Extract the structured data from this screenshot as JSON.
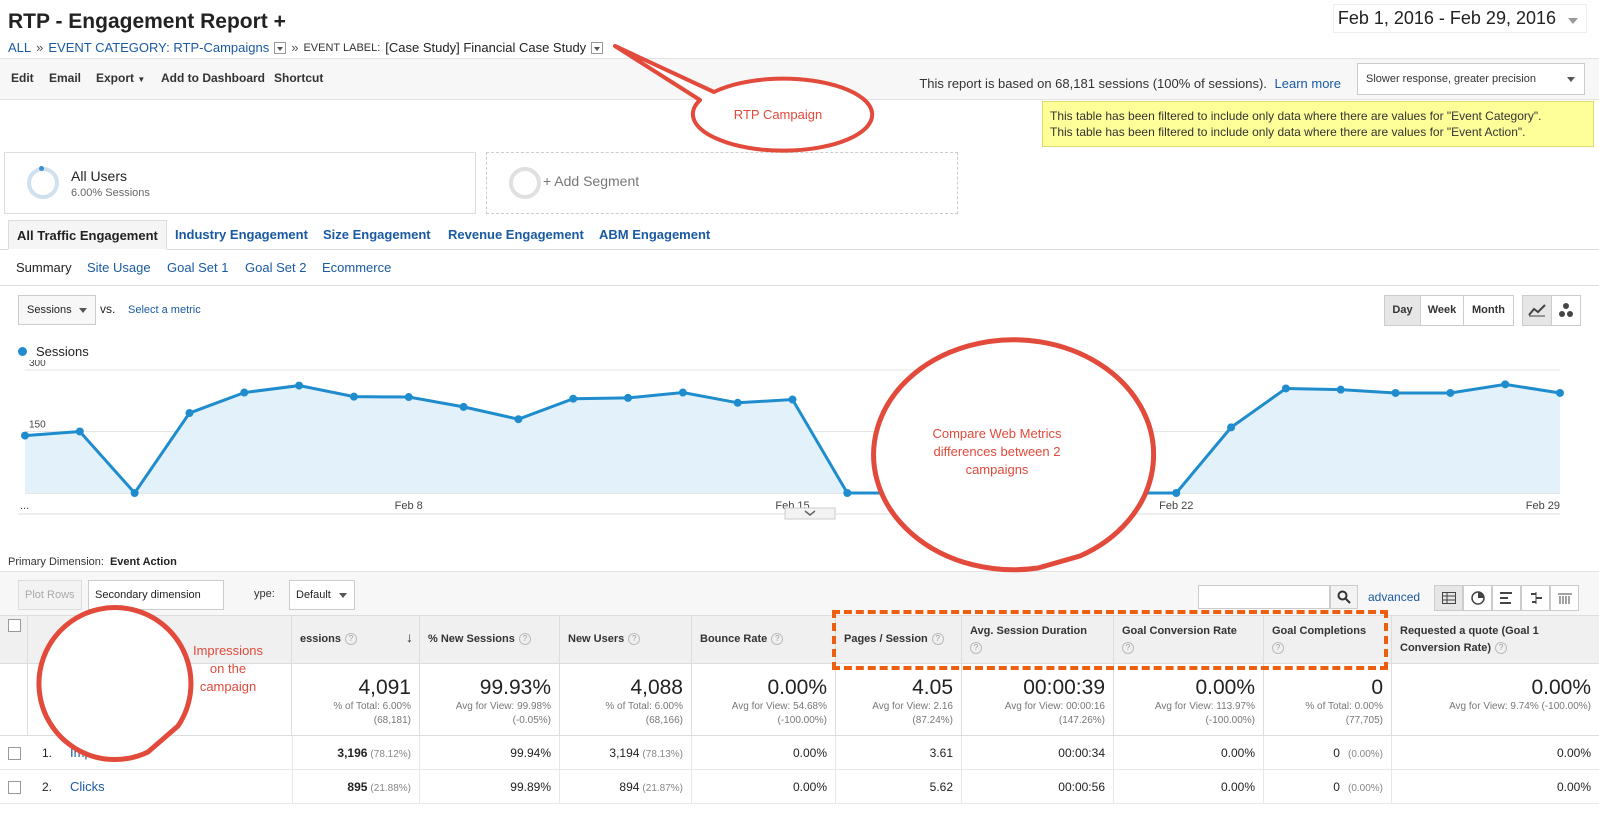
{
  "header": {
    "title": "RTP - Engagement Report +",
    "breadcrumb": {
      "all": "ALL",
      "sep": "»",
      "category_link": "EVENT CATEGORY: RTP-Campaigns",
      "label_prefix": "EVENT LABEL:",
      "label_value": "[Case Study] Financial Case Study"
    },
    "date_range": "Feb 1, 2016 - Feb 29, 2016"
  },
  "toolbar": {
    "edit": "Edit",
    "email": "Email",
    "export": "Export",
    "add_to_dashboard": "Add to Dashboard",
    "shortcut": "Shortcut",
    "report_note": "This report is based on 68,181 sessions (100% of sessions).",
    "learn_more": "Learn more",
    "precision": "Slower response, greater precision"
  },
  "filter_note": {
    "line1": "This table has been filtered to include only data where there are values for \"Event Category\".",
    "line2": "This table has been filtered to include only data where there are values for \"Event Action\"."
  },
  "segments": {
    "all_users": "All Users",
    "all_users_sub": "6.00% Sessions",
    "add_segment": "+ Add Segment"
  },
  "tabs": [
    "All Traffic Engagement",
    "Industry Engagement",
    "Size Engagement",
    "Revenue Engagement",
    "ABM Engagement"
  ],
  "subtabs": [
    "Summary",
    "Site Usage",
    "Goal Set 1",
    "Goal Set 2",
    "Ecommerce"
  ],
  "chart_controls": {
    "metric": "Sessions",
    "vs": "vs.",
    "select_metric": "Select a metric",
    "day": "Day",
    "week": "Week",
    "month": "Month"
  },
  "chart_data": {
    "type": "area",
    "series": [
      {
        "name": "Sessions",
        "values": [
          140,
          150,
          0,
          195,
          245,
          262,
          235,
          234,
          210,
          180,
          230,
          232,
          245,
          220,
          228,
          0,
          0,
          0,
          0,
          0,
          0,
          0,
          160,
          255,
          252,
          244,
          244,
          265,
          244
        ]
      }
    ],
    "x": [
      "Feb 1",
      "Feb 2",
      "Feb 3",
      "Feb 4",
      "Feb 5",
      "Feb 6",
      "Feb 7",
      "Feb 8",
      "Feb 9",
      "Feb 10",
      "Feb 11",
      "Feb 12",
      "Feb 13",
      "Feb 14",
      "Feb 15",
      "Feb 16",
      "Feb 17",
      "Feb 18",
      "Feb 19",
      "Feb 20",
      "Feb 21",
      "Feb 22",
      "Feb 23",
      "Feb 24",
      "Feb 25",
      "Feb 26",
      "Feb 27",
      "Feb 28",
      "Feb 29"
    ],
    "xticks": [
      "...",
      "Feb 8",
      "Feb 15",
      "Feb 22",
      "Feb 29"
    ],
    "yticks": [
      "300",
      "150"
    ],
    "ylim": [
      0,
      300
    ],
    "color": "#1f8ccd",
    "fill": "#e3f1fa",
    "legend": "top-left"
  },
  "primary_dimension": {
    "label": "Primary Dimension:",
    "value": "Event Action"
  },
  "table_toolbar": {
    "plot_rows": "Plot Rows",
    "secondary_dimension": "Secondary dimension",
    "sort_type_label": "ype:",
    "sort_default": "Default",
    "advanced": "advanced"
  },
  "table": {
    "headers": {
      "event_action": "Event Action",
      "sessions": "essions",
      "new_sessions": "% New Sessions",
      "new_users": "New Users",
      "bounce_rate": "Bounce Rate",
      "pages_session": "Pages / Session",
      "avg_duration": "Avg. Session Duration",
      "goal_conv": "Goal Conversion Rate",
      "goal_compl": "Goal Completions",
      "quote": "Requested a quote (Goal 1",
      "quote2": "Conversion Rate)"
    },
    "totals": {
      "sessions": "4,091",
      "sessions_sub1": "% of Total: 6.00%",
      "sessions_sub2": "(68,181)",
      "new_sessions": "99.93%",
      "new_sessions_sub1": "Avg for View: 99.98%",
      "new_sessions_sub2": "(-0.05%)",
      "new_users": "4,088",
      "new_users_sub1": "% of Total: 6.00%",
      "new_users_sub2": "(68,166)",
      "bounce": "0.00%",
      "bounce_sub1": "Avg for View: 54.68%",
      "bounce_sub2": "(-100.00%)",
      "pages": "4.05",
      "pages_sub1": "Avg for View: 2.16",
      "pages_sub2": "(87.24%)",
      "duration": "00:00:39",
      "duration_sub1": "Avg for View: 00:00:16",
      "duration_sub2": "(147.26%)",
      "goal_conv": "0.00%",
      "goal_conv_sub1": "Avg for View: 113.97%",
      "goal_conv_sub2": "(-100.00%)",
      "goal_compl": "0",
      "goal_compl_sub1": "% of Total: 0.00%",
      "goal_compl_sub2": "(77,705)",
      "quote": "0.00%",
      "quote_sub1": "Avg for View: 9.74% (-100.00%)"
    },
    "rows": [
      {
        "num": "1.",
        "action": "Impressions",
        "sessions": "3,196",
        "sessions_pct": "(78.12%)",
        "new_sessions": "99.94%",
        "new_users": "3,194",
        "new_users_pct": "(78.13%)",
        "bounce": "0.00%",
        "pages": "3.61",
        "duration": "00:00:34",
        "goal_conv": "0.00%",
        "goal_compl": "0",
        "goal_compl_pct": "(0.00%)",
        "quote": "0.00%"
      },
      {
        "num": "2.",
        "action": "Clicks",
        "sessions": "895",
        "sessions_pct": "(21.88%)",
        "new_sessions": "99.89%",
        "new_users": "894",
        "new_users_pct": "(21.87%)",
        "bounce": "0.00%",
        "pages": "5.62",
        "duration": "00:00:56",
        "goal_conv": "0.00%",
        "goal_compl": "0",
        "goal_compl_pct": "(0.00%)",
        "quote": "0.00%"
      }
    ]
  },
  "annotations": {
    "rtp_campaign": "RTP Campaign",
    "compare": "Compare Web Metrics differences between 2 campaigns",
    "impressions": "Impressions on the campaign",
    "callout_color": "#e24a3b",
    "dash_color": "#ec5e10"
  }
}
